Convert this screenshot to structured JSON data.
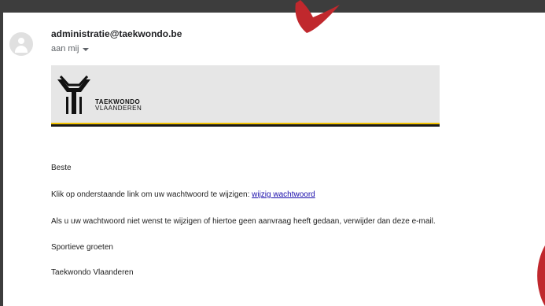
{
  "email": {
    "sender": "administratie@taekwondo.be",
    "recipient": "aan mij",
    "banner": {
      "line1": "TAEKWONDO",
      "line2": "VLAANDEREN"
    },
    "greeting": "Beste",
    "instruction": "Klik op onderstaande link om uw wachtwoord te wijzigen:",
    "link_text": "wijzig wachtwoord",
    "notice": "Als u uw wachtwoord niet wenst te wijzigen of hiertoe geen aanvraag heeft gedaan, verwijder dan deze e-mail.",
    "closing": "Sportieve groeten",
    "signature": "Taekwondo Vlaanderen"
  },
  "icons": {
    "avatar": "person-icon",
    "recipient_details": "caret-down-icon"
  },
  "colors": {
    "link": "#1a0dab",
    "annotation": "#c0282d",
    "banner_stripe_yellow": "#f2c200"
  }
}
